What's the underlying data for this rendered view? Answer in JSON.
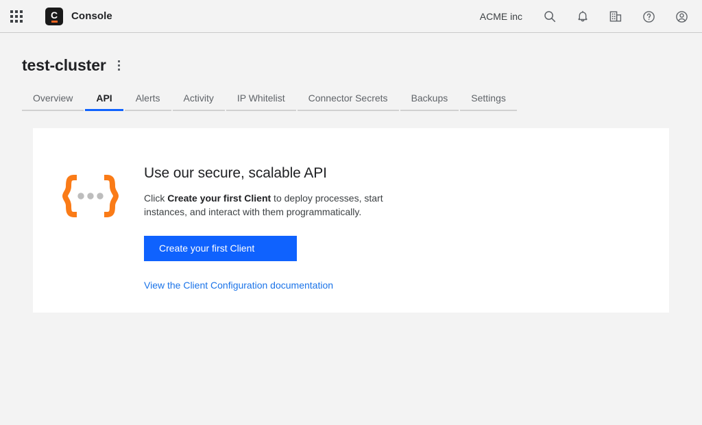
{
  "header": {
    "app_launcher_icon": "apps-grid-icon",
    "brand": {
      "logo_letter": "C",
      "name": "Console"
    },
    "org_name": "ACME inc",
    "icons": [
      {
        "name": "search-icon"
      },
      {
        "name": "notifications-bell-icon"
      },
      {
        "name": "organization-building-icon"
      },
      {
        "name": "help-circle-icon"
      },
      {
        "name": "account-avatar-icon"
      }
    ]
  },
  "page": {
    "title": "test-cluster",
    "kebab_icon": "more-options-icon"
  },
  "tabs": [
    {
      "label": "Overview",
      "active": false
    },
    {
      "label": "API",
      "active": true
    },
    {
      "label": "Alerts",
      "active": false
    },
    {
      "label": "Activity",
      "active": false
    },
    {
      "label": "IP Whitelist",
      "active": false
    },
    {
      "label": "Connector Secrets",
      "active": false
    },
    {
      "label": "Backups",
      "active": false
    },
    {
      "label": "Settings",
      "active": false
    }
  ],
  "card": {
    "illustration_icon": "curly-braces-api-icon",
    "heading": "Use our secure, scalable API",
    "body_prefix": "Click ",
    "body_bold": "Create your first Client",
    "body_suffix": " to deploy processes, start instances, and interact with them programmatically.",
    "primary_button": "Create your first Client",
    "doc_link": "View the Client Configuration documentation"
  },
  "colors": {
    "accent_blue": "#0f62fe",
    "link_blue": "#1a73e8",
    "brand_orange": "#f26522",
    "illustration_orange": "#fa7b17",
    "page_bg": "#f3f3f3",
    "card_bg": "#ffffff"
  }
}
